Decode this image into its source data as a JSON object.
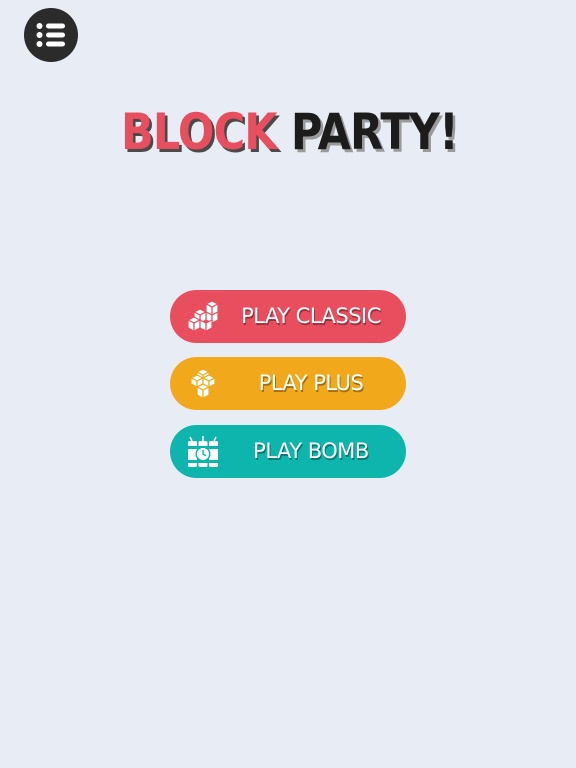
{
  "menu": {
    "icon": "list-menu-icon"
  },
  "title": {
    "word1": "BLOCK",
    "word2": "PARTY!",
    "word1_color": "#e84f5e",
    "word2_color": "#1c1c1c"
  },
  "buttons": [
    {
      "label": "PLAY CLASSIC",
      "icon": "stair-blocks-icon",
      "color": "#e94e5e"
    },
    {
      "label": "PLAY PLUS",
      "icon": "plus-blocks-icon",
      "color": "#f2a81b"
    },
    {
      "label": "PLAY BOMB",
      "icon": "dynamite-timer-icon",
      "color": "#0db5ac"
    }
  ],
  "colors": {
    "background": "#e8ecf4",
    "menu_button": "#2b2b2b"
  }
}
